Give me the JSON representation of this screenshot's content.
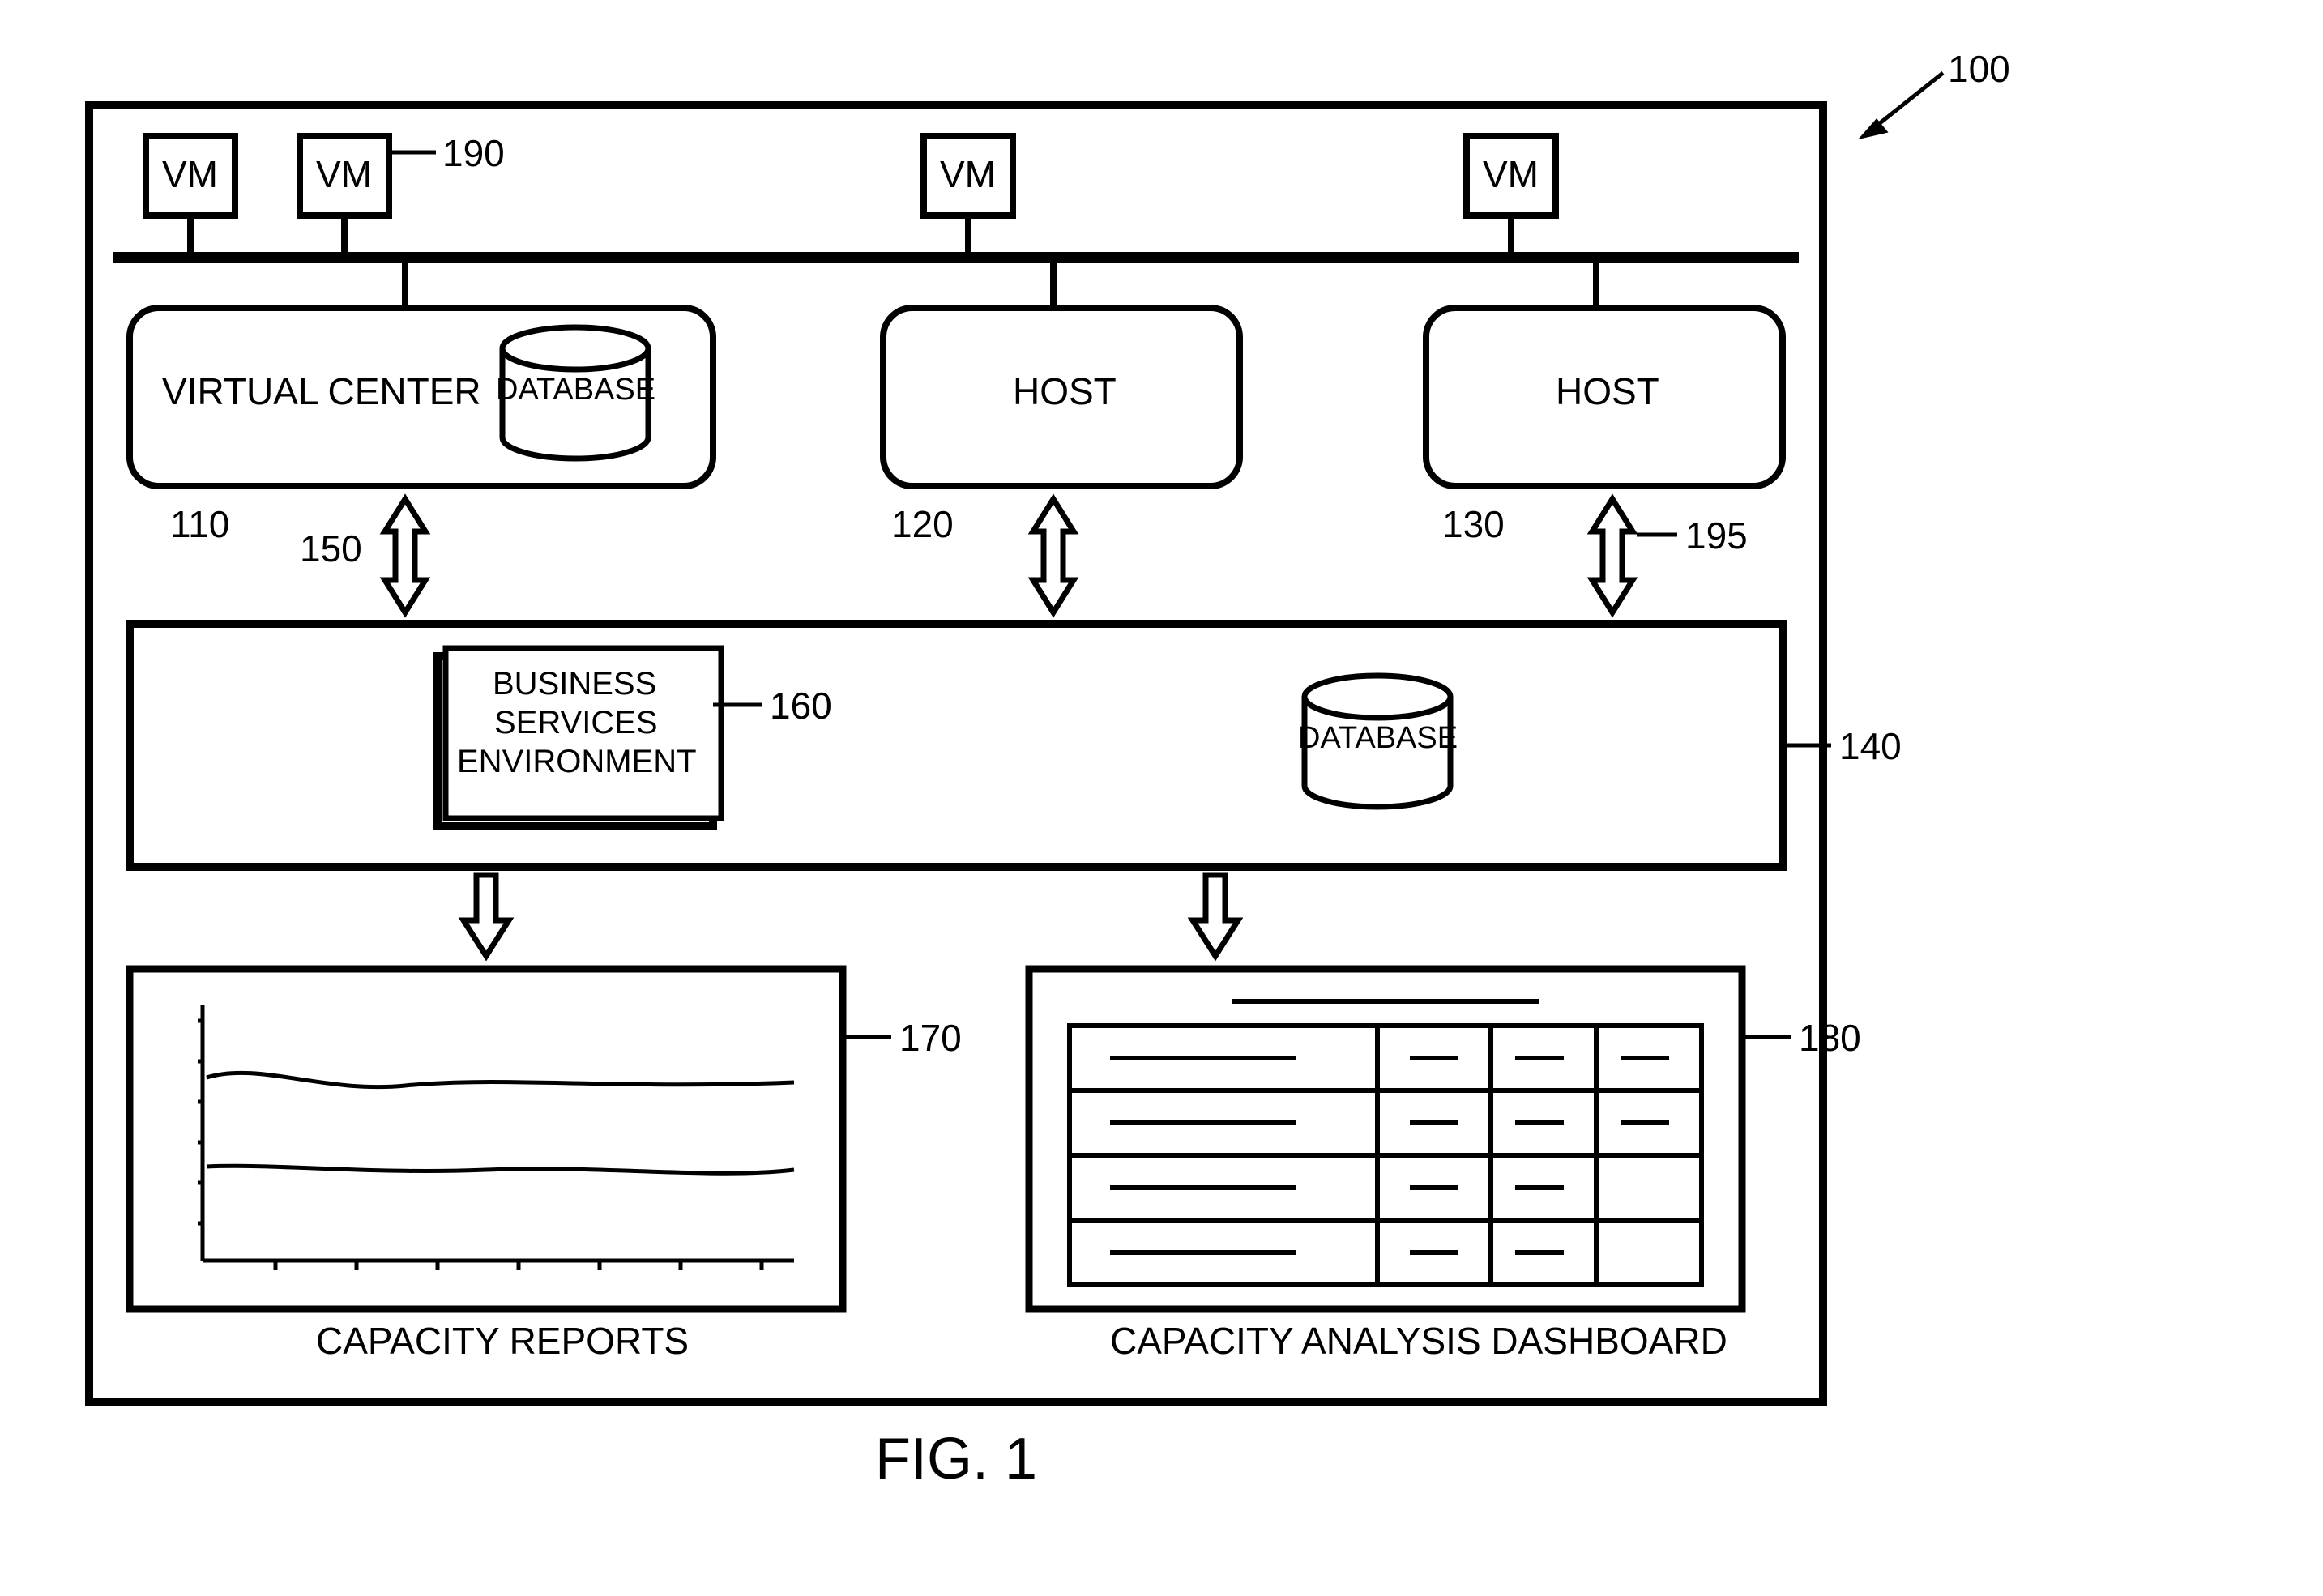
{
  "figure_caption": "FIG. 1",
  "labels": {
    "vm": "VM",
    "virtual_center": "VIRTUAL CENTER",
    "database": "DATABASE",
    "host1": "HOST",
    "host2": "HOST",
    "bse_line1": "BUSINESS",
    "bse_line2": "SERVICES",
    "bse_line3": "ENVIRONMENT",
    "capacity_reports": "CAPACITY REPORTS",
    "capacity_dashboard": "CAPACITY ANALYSIS DASHBOARD"
  },
  "refs": {
    "r100": "100",
    "r110": "110",
    "r120": "120",
    "r130": "130",
    "r140": "140",
    "r150": "150",
    "r160": "160",
    "r170": "170",
    "r180": "180",
    "r190": "190",
    "r195": "195"
  },
  "stroke": "#000",
  "stroke_thin": 5,
  "stroke_thick": 10
}
